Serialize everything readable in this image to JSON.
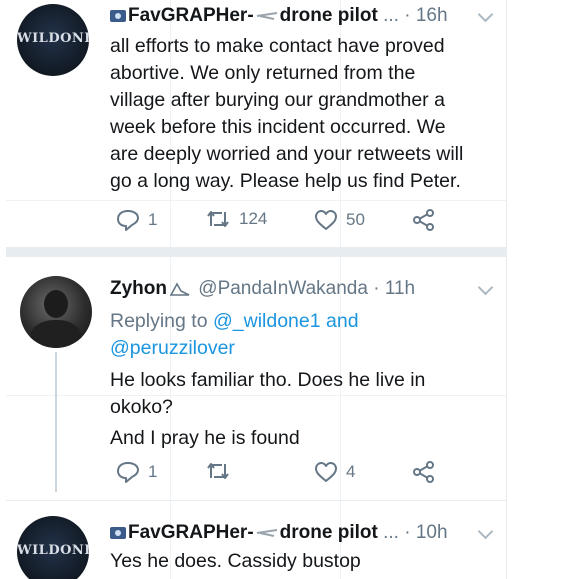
{
  "tweets": [
    {
      "display_name": "FavGRAPHer-",
      "display_name_suffix": "drone pilot",
      "truncation": "...",
      "separator": "·",
      "time": "16h",
      "avatar_text": "WILDONE",
      "text_lines": [
        "all efforts to make contact have proved",
        "abortive. We only returned from the",
        "village after burying our grandmother a",
        "week before this incident occurred.  We",
        "are deeply worried and your retweets will",
        "go a long way. Please help us find Peter."
      ],
      "replies": "1",
      "retweets": "124",
      "likes": "50"
    },
    {
      "display_name": "Zyhon",
      "handle": "@PandaInWakanda",
      "separator": "·",
      "time": "11h",
      "replying_prefix": "Replying to",
      "replying_user1": "@_wildone1",
      "replying_and": "and",
      "replying_user2": "@peruzzilover",
      "text_lines": [
        "He looks familiar tho. Does he live in",
        "okoko?",
        "And I pray he is found"
      ],
      "replies": "1",
      "retweets": "",
      "likes": "4"
    },
    {
      "display_name": "FavGRAPHer-",
      "display_name_suffix": "drone pilot",
      "truncation": "...",
      "separator": "·",
      "time": "10h",
      "avatar_text": "WILDONE",
      "text_lines": [
        "Yes he does. Cassidy bustop"
      ]
    }
  ],
  "colors": {
    "link": "#1b95e0",
    "muted": "#657786",
    "divider": "#e6ecf0"
  },
  "icons": [
    "reply-icon",
    "retweet-icon",
    "like-icon",
    "share-icon",
    "chevron-down-icon"
  ]
}
